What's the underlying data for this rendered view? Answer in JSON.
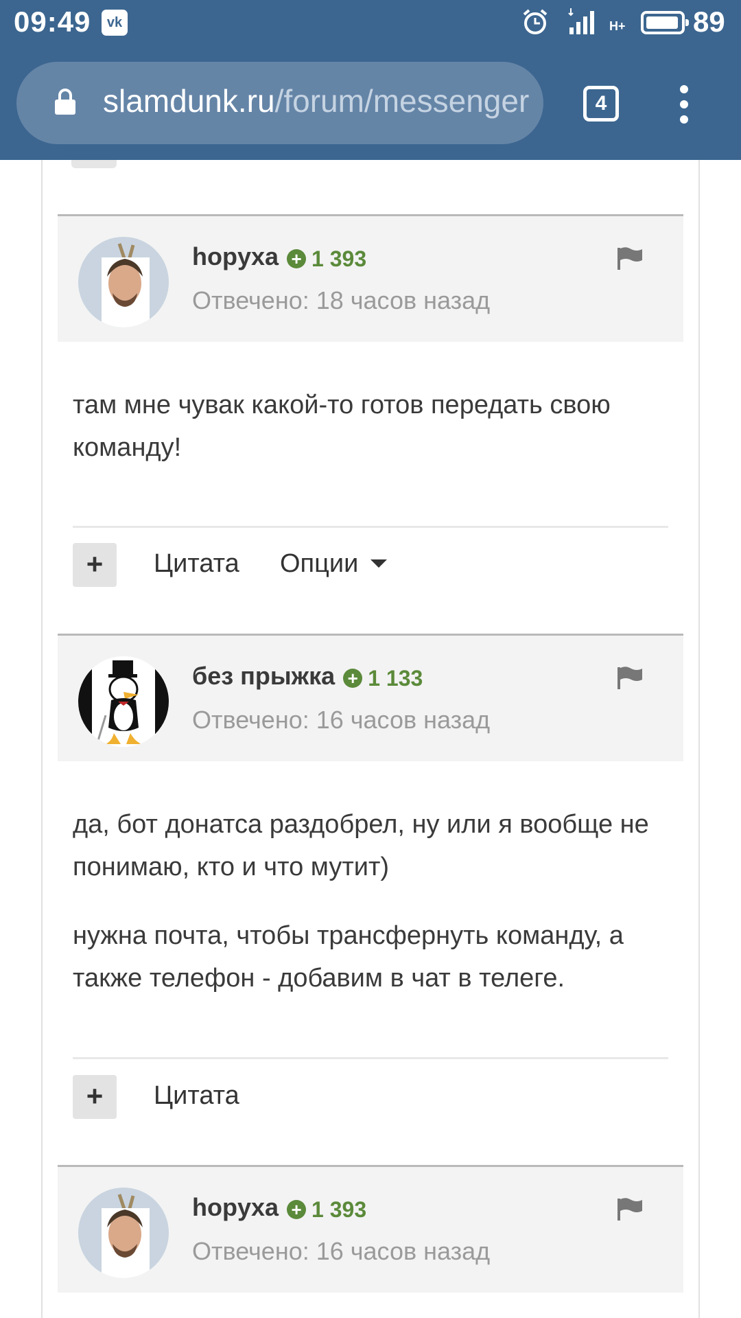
{
  "status_bar": {
    "time": "09:49",
    "network": "H+",
    "battery": "89"
  },
  "browser": {
    "url_host": "slamdunk.ru",
    "url_path": "/forum/messenger",
    "tab_count": "4"
  },
  "posts": [
    {
      "author": "hopyxa",
      "reputation": "1 393",
      "reply_time": "Отвечено: 18 часов назад",
      "body": [
        "там мне чувак какой-то готов передать свою команду!"
      ],
      "actions": {
        "quote": "Цитата",
        "options": "Опции"
      }
    },
    {
      "author": "без прыжка",
      "reputation": "1 133",
      "reply_time": "Отвечено: 16 часов назад",
      "body": [
        "да, бот донатса раздобрел, ну или я вообще не понимаю, кто и что мутит)",
        "нужна почта, чтобы трансфернуть команду, а также телефон - добавим в чат в телеге."
      ],
      "actions": {
        "quote": "Цитата"
      }
    },
    {
      "author": "hopyxa",
      "reputation": "1 393",
      "reply_time": "Отвечено: 16 часов назад"
    }
  ],
  "icons": {
    "plus": "+",
    "vk": "vk",
    "rep": "+"
  },
  "colors": {
    "header_blue": "#3c6690",
    "reputation_green": "#5b8a3a"
  }
}
